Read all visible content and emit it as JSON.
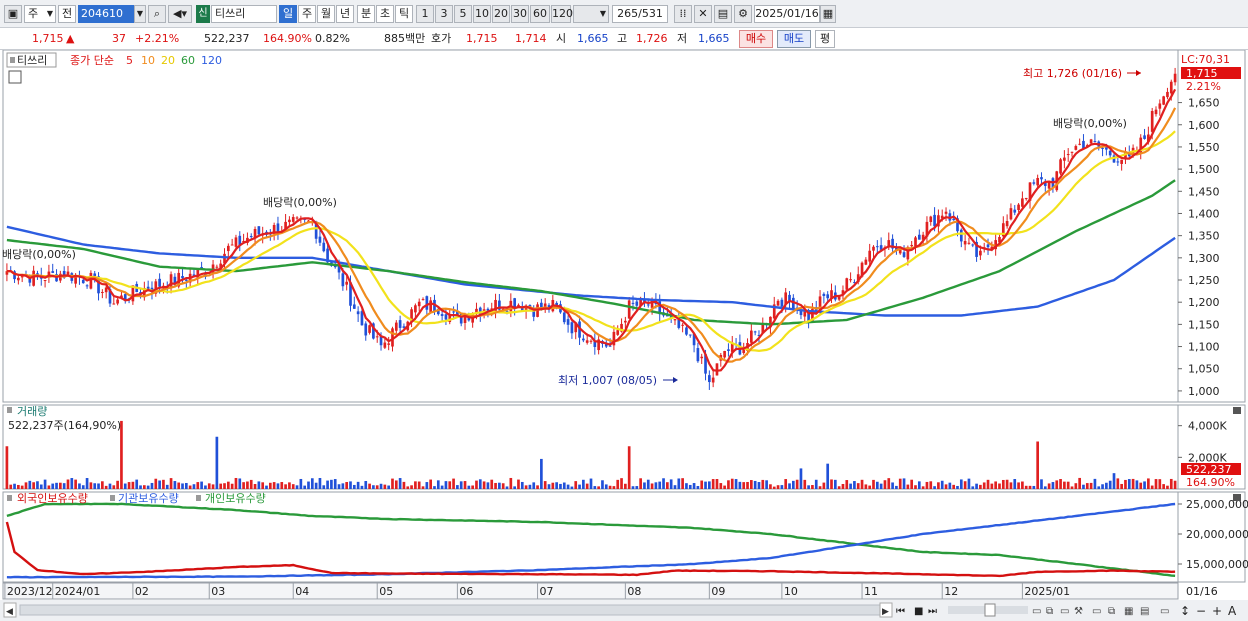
{
  "toolbar": {
    "market_label": "주",
    "prev_label": "전",
    "code_value": "204610",
    "market_badge": "신",
    "stock_name": "티쓰리",
    "periods": [
      "일",
      "주",
      "월",
      "년",
      "분",
      "초",
      "틱"
    ],
    "intervals": [
      "1",
      "3",
      "5",
      "10",
      "20",
      "30",
      "60",
      "120"
    ],
    "count_value": "265",
    "count_total": "/531",
    "date_value": "2025/01/16"
  },
  "quote": {
    "price": "1,715",
    "direction": "▲",
    "change": "37",
    "change_pct": "+2.21%",
    "volume": "522,237",
    "volume_ratio": "164.90%",
    "turnover_pct": "0.82%",
    "amount": "885백만",
    "hoga_label": "호가",
    "ask": "1,715",
    "bid": "1,714",
    "open_label": "시",
    "open": "1,665",
    "high_label": "고",
    "high": "1,726",
    "low_label": "저",
    "low": "1,665",
    "buy_label": "매수",
    "sell_label": "매도",
    "eval_label": "평"
  },
  "price_legend": {
    "name": "티쓰리",
    "ma_label": "종가 단순",
    "ma_periods": [
      "5",
      "10",
      "20",
      "60",
      "120"
    ],
    "ma_colors": [
      "#e02020",
      "#f08c1e",
      "#f2e21c",
      "#2a9a3a",
      "#2d5de0"
    ]
  },
  "volume_legend": {
    "title": "거래량",
    "value": "522,237주(164,90%)"
  },
  "holding_legend": {
    "items": [
      "외국인보유수량",
      "기관보유수량",
      "개인보유수량"
    ],
    "colors": [
      "#d41010",
      "#2d5de0",
      "#2a9a3a"
    ]
  },
  "chart_data": [
    {
      "type": "candlestick",
      "name": "price",
      "y_ticks": [
        1000,
        1050,
        1100,
        1150,
        1200,
        1250,
        1300,
        1350,
        1400,
        1450,
        1500,
        1550,
        1600,
        1650
      ],
      "y_tick_labels": [
        "1,000",
        "1,050",
        "1,100",
        "1,150",
        "1,200",
        "1,250",
        "1,300",
        "1,350",
        "1,400",
        "1,450",
        "1,500",
        "1,550",
        "1,600",
        "1,650"
      ],
      "ylim": [
        975,
        1755
      ],
      "lc_label": "LC:70,31",
      "current_price": "1,715",
      "current_change": "2.21%",
      "annotations": [
        {
          "text": "최고 1,726 (01/16)",
          "date": "2025/01/16",
          "value": 1726
        },
        {
          "text": "최저 1,007 (08/05)",
          "date": "2024/08/05",
          "value": 1007
        },
        {
          "text": "배당락(0,00%)",
          "date": "2023/12/27",
          "value": 1290
        },
        {
          "text": "배당락(0,00%)",
          "date": "2024/03/27",
          "value": 1395
        },
        {
          "text": "배당락(0,00%)",
          "date": "2024/12/27",
          "value": 1590
        }
      ],
      "close_anchors": [
        [
          0,
          1270
        ],
        [
          8,
          1255
        ],
        [
          15,
          1265
        ],
        [
          22,
          1250
        ],
        [
          28,
          1200
        ],
        [
          34,
          1225
        ],
        [
          40,
          1240
        ],
        [
          46,
          1255
        ],
        [
          52,
          1270
        ],
        [
          58,
          1320
        ],
        [
          64,
          1350
        ],
        [
          70,
          1365
        ],
        [
          75,
          1375
        ],
        [
          80,
          1380
        ],
        [
          84,
          1300
        ],
        [
          89,
          1230
        ],
        [
          93,
          1150
        ],
        [
          98,
          1100
        ],
        [
          103,
          1150
        ],
        [
          108,
          1195
        ],
        [
          113,
          1190
        ],
        [
          118,
          1160
        ],
        [
          123,
          1185
        ],
        [
          128,
          1195
        ],
        [
          133,
          1200
        ],
        [
          138,
          1185
        ],
        [
          143,
          1190
        ],
        [
          148,
          1145
        ],
        [
          153,
          1120
        ],
        [
          158,
          1100
        ],
        [
          163,
          1190
        ],
        [
          168,
          1195
        ],
        [
          172,
          1170
        ],
        [
          176,
          1140
        ],
        [
          180,
          1105
        ],
        [
          184,
          1015
        ],
        [
          188,
          1090
        ],
        [
          193,
          1100
        ],
        [
          198,
          1145
        ],
        [
          202,
          1210
        ],
        [
          206,
          1200
        ],
        [
          210,
          1165
        ],
        [
          214,
          1210
        ],
        [
          218,
          1220
        ],
        [
          222,
          1260
        ],
        [
          226,
          1320
        ],
        [
          230,
          1340
        ],
        [
          234,
          1305
        ],
        [
          238,
          1350
        ],
        [
          242,
          1380
        ],
        [
          246,
          1410
        ],
        [
          249,
          1360
        ],
        [
          252,
          1320
        ],
        [
          255,
          1300
        ],
        [
          258,
          1340
        ],
        [
          262,
          1380
        ],
        [
          266,
          1440
        ],
        [
          270,
          1470
        ],
        [
          274,
          1470
        ],
        [
          278,
          1540
        ],
        [
          282,
          1560
        ],
        [
          286,
          1550
        ],
        [
          290,
          1530
        ],
        [
          294,
          1520
        ],
        [
          298,
          1570
        ],
        [
          301,
          1640
        ],
        [
          304,
          1690
        ],
        [
          306,
          1715
        ]
      ],
      "ma120_anchors": [
        [
          0,
          1370
        ],
        [
          20,
          1330
        ],
        [
          40,
          1310
        ],
        [
          60,
          1300
        ],
        [
          80,
          1300
        ],
        [
          100,
          1270
        ],
        [
          120,
          1240
        ],
        [
          150,
          1215
        ],
        [
          170,
          1205
        ],
        [
          190,
          1200
        ],
        [
          210,
          1180
        ],
        [
          230,
          1170
        ],
        [
          250,
          1170
        ],
        [
          270,
          1190
        ],
        [
          290,
          1250
        ],
        [
          306,
          1345
        ]
      ],
      "ma60_anchors": [
        [
          0,
          1340
        ],
        [
          20,
          1320
        ],
        [
          40,
          1280
        ],
        [
          60,
          1270
        ],
        [
          80,
          1290
        ],
        [
          100,
          1270
        ],
        [
          120,
          1245
        ],
        [
          140,
          1225
        ],
        [
          160,
          1195
        ],
        [
          180,
          1160
        ],
        [
          200,
          1150
        ],
        [
          220,
          1160
        ],
        [
          240,
          1210
        ],
        [
          260,
          1270
        ],
        [
          280,
          1360
        ],
        [
          300,
          1440
        ],
        [
          306,
          1475
        ]
      ]
    },
    {
      "type": "bar",
      "name": "volume",
      "y_tick_labels": [
        "4,000K",
        "2,000K"
      ],
      "y_ticks": [
        4000,
        2000
      ],
      "ylim": [
        0,
        4800
      ],
      "last_value": "522,237",
      "last_ratio": "164.90%",
      "spikes": [
        [
          0,
          2700
        ],
        [
          30,
          4300
        ],
        [
          55,
          3300
        ],
        [
          140,
          1900
        ],
        [
          163,
          2700
        ],
        [
          208,
          1300
        ],
        [
          215,
          1600
        ],
        [
          270,
          3000
        ],
        [
          290,
          1000
        ]
      ]
    },
    {
      "type": "line",
      "name": "holdings",
      "y_ticks": [
        25000000,
        20000000,
        15000000
      ],
      "y_tick_labels": [
        "25,000,000",
        "20,000,000",
        "15,000,000"
      ],
      "ylim": [
        12000000,
        27000000
      ],
      "series": [
        {
          "name": "외국인보유수량",
          "color": "#d41010",
          "anchors": [
            [
              0,
              22000000
            ],
            [
              2,
              17000000
            ],
            [
              8,
              14000000
            ],
            [
              20,
              13300000
            ],
            [
              40,
              13800000
            ],
            [
              60,
              14500000
            ],
            [
              75,
              14800000
            ],
            [
              85,
              13500000
            ],
            [
              100,
              13400000
            ],
            [
              140,
              13300000
            ],
            [
              165,
              13200000
            ],
            [
              175,
              13900000
            ],
            [
              200,
              13800000
            ],
            [
              240,
              13300000
            ],
            [
              260,
              13000000
            ],
            [
              270,
              13700000
            ],
            [
              290,
              13900000
            ],
            [
              306,
              13700000
            ]
          ]
        },
        {
          "name": "기관보유수량",
          "color": "#2d5de0",
          "anchors": [
            [
              0,
              12800000
            ],
            [
              60,
              12900000
            ],
            [
              100,
              13300000
            ],
            [
              140,
              14000000
            ],
            [
              180,
              15000000
            ],
            [
              200,
              16000000
            ],
            [
              220,
              18000000
            ],
            [
              240,
              20000000
            ],
            [
              260,
              21500000
            ],
            [
              280,
              23000000
            ],
            [
              306,
              25000000
            ]
          ]
        },
        {
          "name": "개인보유수량",
          "color": "#2a9a3a",
          "anchors": [
            [
              0,
              23000000
            ],
            [
              10,
              25000000
            ],
            [
              30,
              25000000
            ],
            [
              60,
              24000000
            ],
            [
              80,
              23000000
            ],
            [
              100,
              22500000
            ],
            [
              140,
              22000000
            ],
            [
              180,
              21000000
            ],
            [
              200,
              20000000
            ],
            [
              220,
              18500000
            ],
            [
              240,
              17000000
            ],
            [
              260,
              16500000
            ],
            [
              280,
              15000000
            ],
            [
              300,
              13500000
            ],
            [
              306,
              13000000
            ]
          ]
        }
      ]
    }
  ],
  "x_axis": {
    "labels": [
      "2023/12",
      "2024/01",
      "02",
      "03",
      "04",
      "05",
      "06",
      "07",
      "08",
      "09",
      "10",
      "11",
      "12",
      "2025/01"
    ],
    "right_label": "01/16"
  }
}
